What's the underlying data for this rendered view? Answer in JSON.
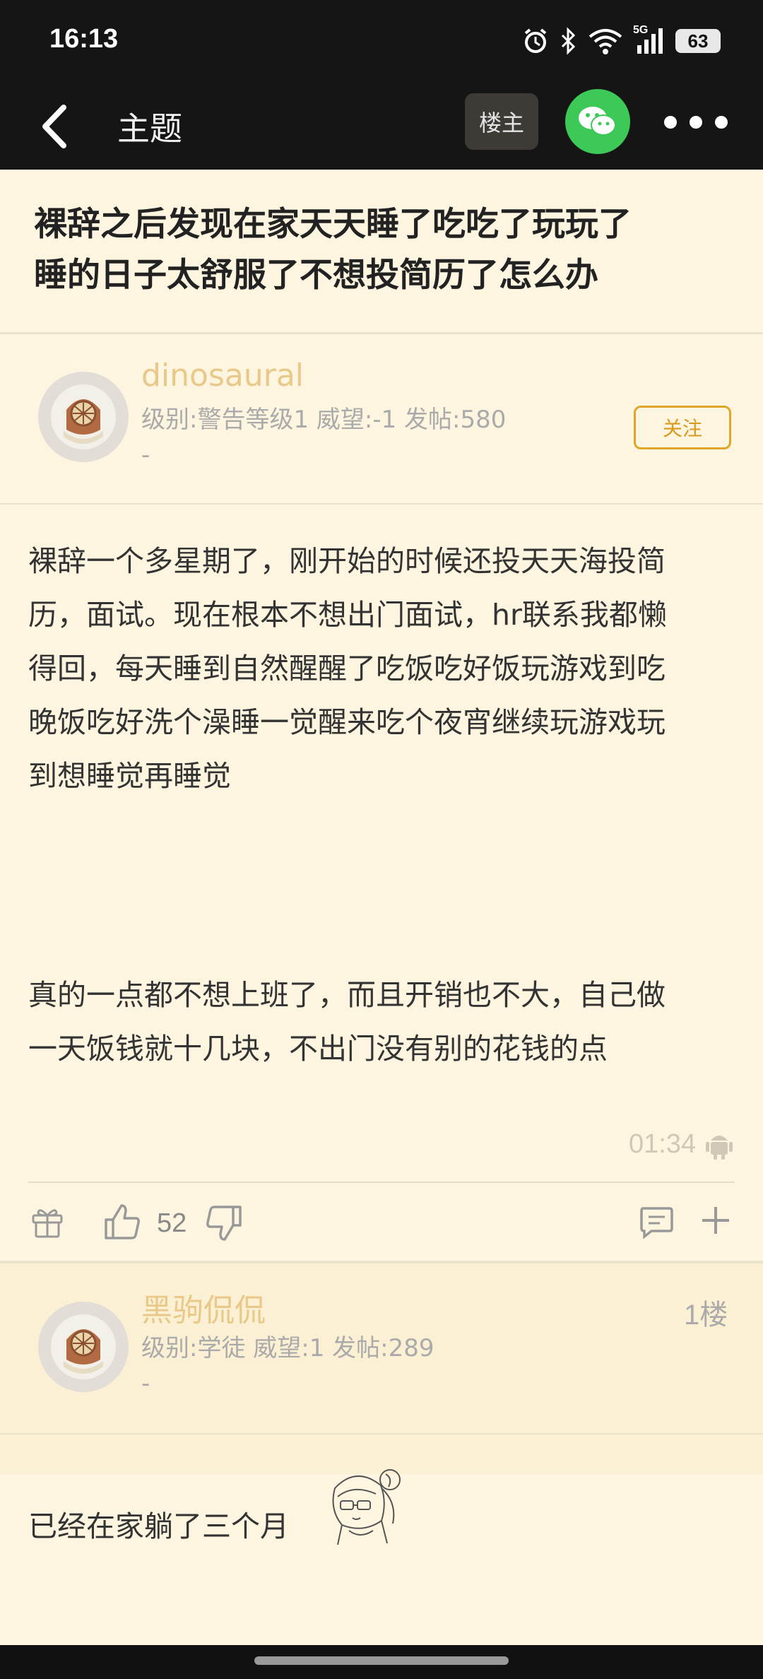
{
  "status_bar": {
    "time": "16:13",
    "network": "5G",
    "battery": "63"
  },
  "nav": {
    "title": "主题",
    "op_label": "楼主"
  },
  "thread": {
    "title_line1": "裸辞之后发现在家天天睡了吃吃了玩玩了",
    "title_line2": "睡的日子太舒服了不想投简历了怎么办"
  },
  "op_post": {
    "username": "dinosaural",
    "info": "级别:警告等级1 威望:-1 发帖:580",
    "dash": "-",
    "follow_label": "关注",
    "para1_lines": [
      "裸辞一个多星期了，刚开始的时候还投天天海投简",
      "历，面试。现在根本不想出门面试，hr联系我都懒",
      "得回，每天睡到自然醒醒了吃饭吃好饭玩游戏到吃",
      "晚饭吃好洗个澡睡一觉醒来吃个夜宵继续玩游戏玩",
      "到想睡觉再睡觉"
    ],
    "para2_lines": [
      "真的一点都不想上班了，而且开销也不大，自己做",
      "一天饭钱就十几块，不出门没有别的花钱的点"
    ],
    "time": "01:34",
    "device_icon": "android-icon",
    "like_count": "52"
  },
  "reply": {
    "username": "黑驹侃侃",
    "info": "级别:学徒 威望:1 发帖:289",
    "dash": "-",
    "floor": "1楼",
    "body": "已经在家躺了三个月"
  },
  "colors": {
    "background": "#fdf5df",
    "username": "#e8c989",
    "follow": "#d9991c",
    "wechat": "#3cc957"
  }
}
